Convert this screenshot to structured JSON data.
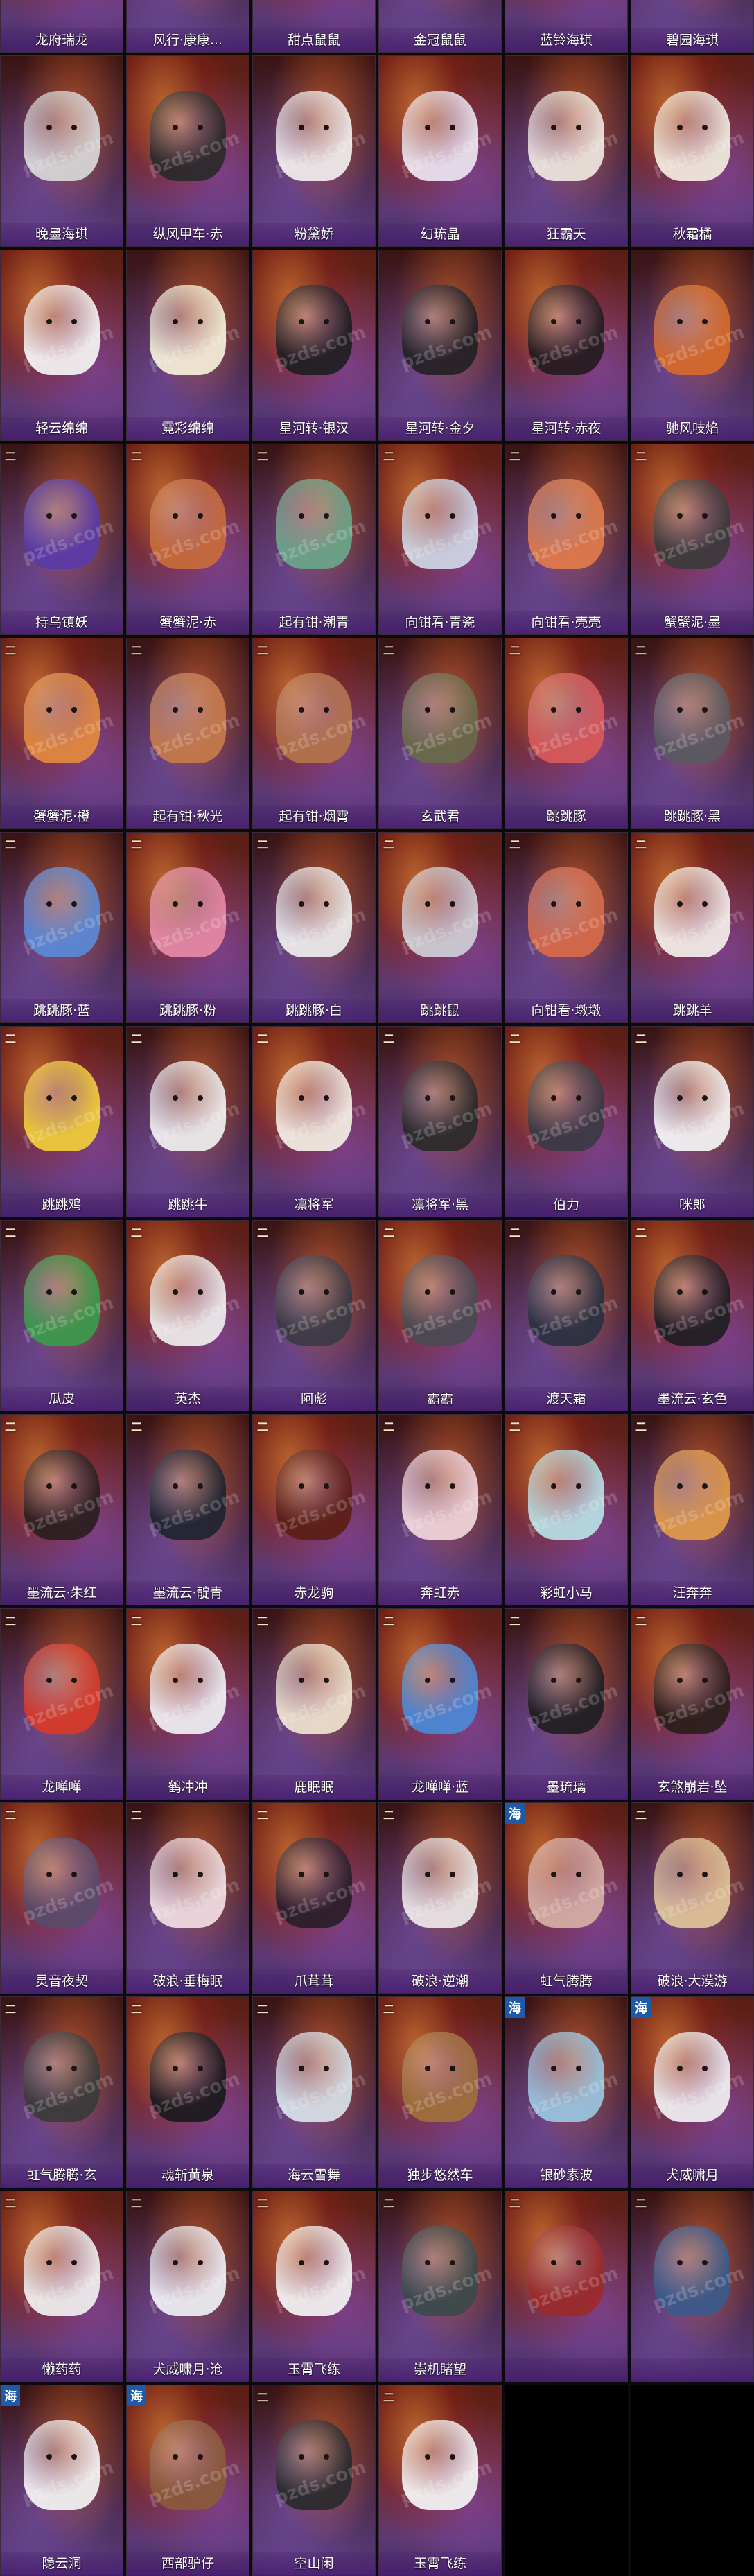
{
  "watermark": "pzds.com",
  "badge": "二",
  "sea_badge": "海",
  "items": [
    {
      "label": "龙府瑞龙",
      "color": "#cfcfcf"
    },
    {
      "label": "风行·康康...",
      "color": "#2b2b2b"
    },
    {
      "label": "甜点鼠鼠",
      "color": "#f3f0ee"
    },
    {
      "label": "金冠鼠鼠",
      "color": "#ede7ef"
    },
    {
      "label": "蓝铃海琪",
      "color": "#f1ece4"
    },
    {
      "label": "碧园海琪",
      "color": "#f4efe6"
    },
    {
      "label": "晚墨海琪",
      "color": "#d8d8d8"
    },
    {
      "label": "纵风甲车·赤",
      "color": "#2a2a2a"
    },
    {
      "label": "粉黛娇",
      "color": "#f2eeee"
    },
    {
      "label": "幻琉晶",
      "color": "#ece6f2"
    },
    {
      "label": "狂霸天",
      "color": "#efe7e0"
    },
    {
      "label": "秋霜橘",
      "color": "#f3ede0"
    },
    {
      "label": "轻云绵绵",
      "color": "#f6f4f4"
    },
    {
      "label": "霓彩绵绵",
      "color": "#f5f0d8"
    },
    {
      "label": "星河转·银汉",
      "color": "#1e1e22"
    },
    {
      "label": "星河转·金夕",
      "color": "#222025"
    },
    {
      "label": "星河转·赤夜",
      "color": "#231c1f"
    },
    {
      "label": "驰风吱焰",
      "color": "#d76a2a"
    },
    {
      "label": "持乌镇妖",
      "color": "#5a3aa8"
    },
    {
      "label": "蟹蟹泥·赤",
      "color": "#c86b3a"
    },
    {
      "label": "起有钳·潮青",
      "color": "#6aa68a"
    },
    {
      "label": "向钳看·青瓷",
      "color": "#cfd8e6"
    },
    {
      "label": "向钳看·壳壳",
      "color": "#e07a4a"
    },
    {
      "label": "蟹蟹泥·墨",
      "color": "#3a3a3a"
    },
    {
      "label": "蟹蟹泥·橙",
      "color": "#e38a3e"
    },
    {
      "label": "起有钳·秋光",
      "color": "#c77a4a"
    },
    {
      "label": "起有钳·烟霄",
      "color": "#b4744a"
    },
    {
      "label": "玄武君",
      "color": "#6a6a4a"
    },
    {
      "label": "跳跳豚",
      "color": "#d85a5a"
    },
    {
      "label": "跳跳豚·黑",
      "color": "#5a5a62"
    },
    {
      "label": "跳跳豚·蓝",
      "color": "#5a8ad8"
    },
    {
      "label": "跳跳豚·粉",
      "color": "#e88aa8"
    },
    {
      "label": "跳跳豚·白",
      "color": "#eeeeee"
    },
    {
      "label": "跳跳鼠",
      "color": "#cfcfd6"
    },
    {
      "label": "向钳看·墩墩",
      "color": "#d86a4a"
    },
    {
      "label": "跳跳羊",
      "color": "#f4efea"
    },
    {
      "label": "跳跳鸡",
      "color": "#f2cf3a"
    },
    {
      "label": "跳跳牛",
      "color": "#f0f0f0"
    },
    {
      "label": "凛将军",
      "color": "#f4efe4"
    },
    {
      "label": "凛将军·黑",
      "color": "#2a2a2a"
    },
    {
      "label": "伯力",
      "color": "#3a3a44"
    },
    {
      "label": "咪郎",
      "color": "#f6f6f6"
    },
    {
      "label": "瓜皮",
      "color": "#3a9a4a"
    },
    {
      "label": "英杰",
      "color": "#eeeeee"
    },
    {
      "label": "阿彪",
      "color": "#3a3a44"
    },
    {
      "label": "霸霸",
      "color": "#4a4a52"
    },
    {
      "label": "渡天霜",
      "color": "#2a3040"
    },
    {
      "label": "墨流云·玄色",
      "color": "#1e1e22"
    },
    {
      "label": "墨流云·朱红",
      "color": "#2a1e1e"
    },
    {
      "label": "墨流云·靛青",
      "color": "#1e2430"
    },
    {
      "label": "赤龙驹",
      "color": "#5a1e14"
    },
    {
      "label": "奔虹赤",
      "color": "#f2d6dc"
    },
    {
      "label": "彩虹小马",
      "color": "#b8e0e6"
    },
    {
      "label": "汪奔奔",
      "color": "#e09a4a"
    },
    {
      "label": "龙啴啴",
      "color": "#d83a2a"
    },
    {
      "label": "鹤冲冲",
      "color": "#f0f0f4"
    },
    {
      "label": "鹿眠眠",
      "color": "#efe4d0"
    },
    {
      "label": "龙啴啴·蓝",
      "color": "#4a8ad8"
    },
    {
      "label": "墨琉璃",
      "color": "#1e1e22"
    },
    {
      "label": "玄煞崩岩·坠",
      "color": "#2a1e1a"
    },
    {
      "label": "灵音夜契",
      "color": "#5a4a6a"
    },
    {
      "label": "破浪·垂梅眠",
      "color": "#f2dfe4"
    },
    {
      "label": "爪茸茸",
      "color": "#2a1e2a"
    },
    {
      "label": "破浪·逆潮",
      "color": "#ece8e8"
    },
    {
      "label": "虹气腾腾",
      "color": "#d6b0a6"
    },
    {
      "label": "破浪·大漠游",
      "color": "#e0c49a"
    },
    {
      "label": "虹气腾腾·玄",
      "color": "#3a3a3a"
    },
    {
      "label": "魂斩黄泉",
      "color": "#1a1a1e"
    },
    {
      "label": "海云雪舞",
      "color": "#d8e2ea"
    },
    {
      "label": "独步悠然车",
      "color": "#a0703a"
    },
    {
      "label": "银砂素波",
      "color": "#9ac6e0"
    },
    {
      "label": "犬威啸月",
      "color": "#f0f0f4"
    },
    {
      "label": "懒药药",
      "color": "#f0f0f0"
    },
    {
      "label": "犬威啸月·沧",
      "color": "#eef0f6"
    },
    {
      "label": "玉霄飞练",
      "color": "#f4f4f4"
    },
    {
      "label": "崇机睹望",
      "color": "#3a4a4a"
    },
    {
      "label": "",
      "color": "#9a2a2a"
    },
    {
      "label": "",
      "color": "#3a5a8a"
    },
    {
      "label": "隐云洞",
      "color": "#f4f4f4"
    },
    {
      "label": "西部驴仔",
      "color": "#8a5a3a"
    },
    {
      "label": "空山闲",
      "color": "#2a2a2e"
    },
    {
      "label": "玉霄飞练",
      "color": "#f6f6f6"
    }
  ]
}
